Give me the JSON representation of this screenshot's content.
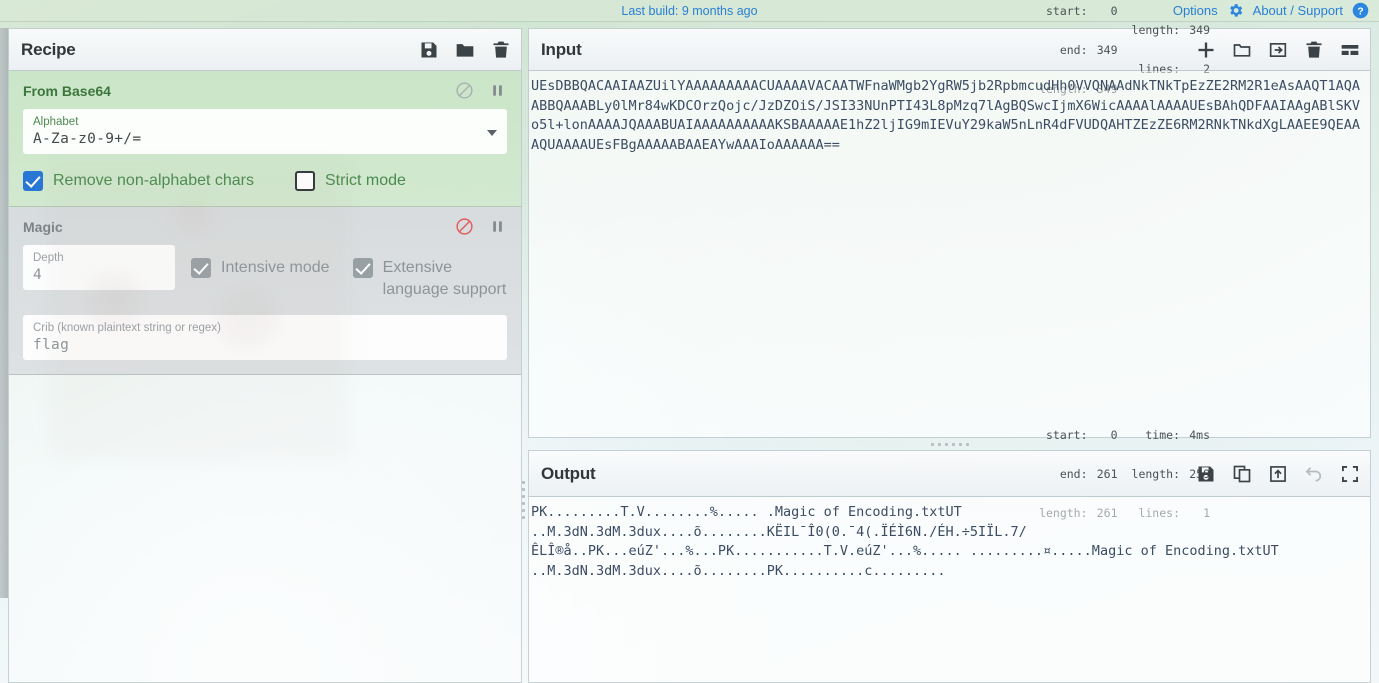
{
  "banner": {
    "build_text": "Last build: 9 months ago",
    "options_label": "Options",
    "about_label": "About / Support",
    "gear_icon": "gear-icon",
    "help_icon": "question-circle-icon",
    "link_color": "#2a7fd4"
  },
  "recipe": {
    "title": "Recipe",
    "icons": [
      "save-icon",
      "folder-icon",
      "trash-icon"
    ],
    "operations": [
      {
        "name": "From Base64",
        "state": "enabled",
        "disable_icon": "ban-icon",
        "pause_icon": "pause-icon",
        "args": {
          "alphabet_label": "Alphabet",
          "alphabet_value": "A-Za-z0-9+/=",
          "remove_non_alphabet_label": "Remove non-alphabet chars",
          "remove_non_alphabet_checked": true,
          "strict_mode_label": "Strict mode",
          "strict_mode_checked": false
        }
      },
      {
        "name": "Magic",
        "state": "disabled",
        "disable_icon": "ban-icon",
        "pause_icon": "pause-icon",
        "args": {
          "depth_label": "Depth",
          "depth_value": "4",
          "intensive_label": "Intensive mode",
          "intensive_checked": true,
          "extensive_label": "Extensive language support",
          "extensive_checked": true,
          "crib_label": "Crib (known plaintext string or regex)",
          "crib_value": "flag"
        }
      }
    ]
  },
  "input": {
    "title": "Input",
    "stats": {
      "start_label": "start:",
      "start_value": "0",
      "end_label": "end:",
      "end_value": "349",
      "length_label": "length:",
      "length_value": "349",
      "length2_label": "length:",
      "length2_value": "349",
      "lines_label": "lines:",
      "lines_value": "2"
    },
    "icons": [
      "add-tab-icon",
      "open-folder-icon",
      "open-file-icon",
      "clear-icon",
      "tabs-icon"
    ],
    "text": "UEsDBBQACAAIAAZUilYAAAAAAAAACUAAAAVACAATWFnaWMgb2YgRW5jb2RpbmcudHh0VVQNAAdNkTNkTpEzZE2RM2R1eAsAAQT1AQAABBQAAABLy0lMr84wKDCOrzQojc/JzDZOiS/JSI33NUnPTI43L8pMzq7lAgBQSwcIjmX6WicAAAAlAAAAUEsBAhQDFAAIAAgABlSKVo5l+lonAAAAJQAAABUAIAAAAAAAAAAKSBAAAAAE1hZ2ljIG9mIEVuY29kaW5nLnR4dFVUDQAHTZEzZE6RM2RNkTNkdXgLAAEE9QEAAAQUAAAAUEsFBgAAAAABAAEAYwAAAIoAAAAAA=="
  },
  "output": {
    "title": "Output",
    "stats": {
      "start_label": "start:",
      "start_value": "0",
      "end_label": "end:",
      "end_value": "261",
      "length_label": "length:",
      "length_value": "261",
      "time_label": "time:",
      "time_value": "4ms",
      "length2_label": "length:",
      "length2_value": "259",
      "lines_label": "lines:",
      "lines_value": "1"
    },
    "icons": [
      "save-icon",
      "copy-icon",
      "bake-to-input-icon",
      "undo-icon",
      "maximise-icon"
    ],
    "text": "PK.........T.V........%..... .Magic of Encoding.txtUT\n..M.3dN.3dM.3dux....õ........KËIL¯Î0(0.¯4(.ÏÉÌ6N./ÉH.÷5IÏL.7/\nÊLÎ®å..PK...eúZ'...%...PK...........T.V.eúZ'...%..... .........¤.....Magic of Encoding.txtUT\n..M.3dN.3dM.3dux....õ........PK..........c........."
  }
}
